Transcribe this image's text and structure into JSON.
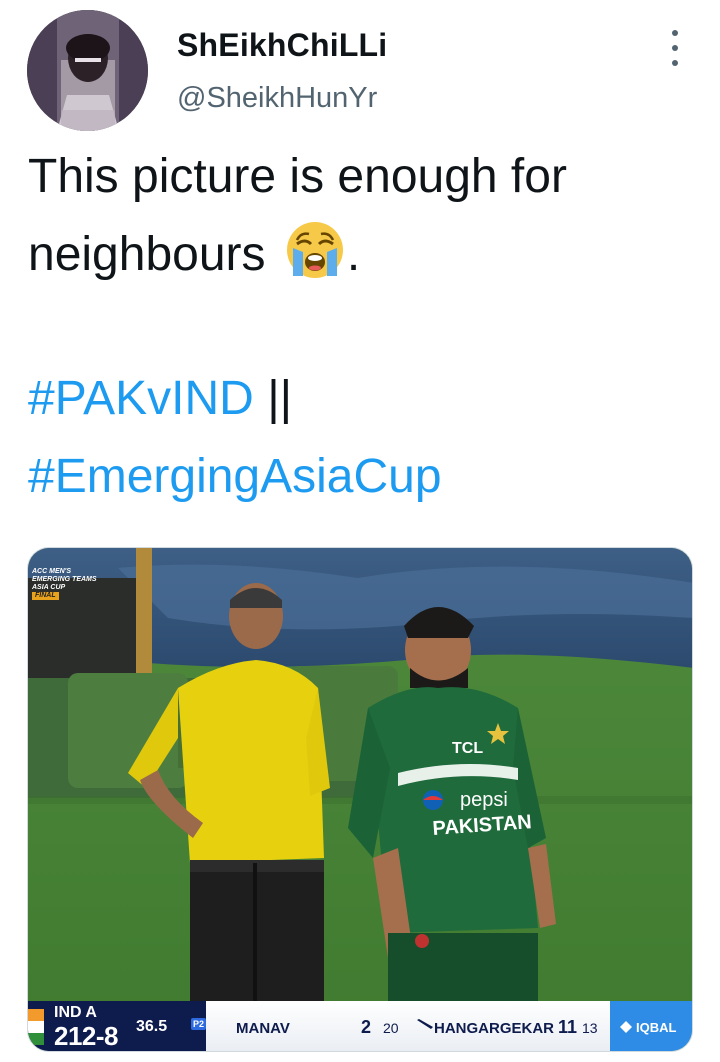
{
  "user": {
    "display_name": "ShEikhChiLLi",
    "handle": "@SheikhHunYr"
  },
  "tweet": {
    "text": "This picture is enough for neighbours",
    "emoji": "loudly-crying-face",
    "text_end": ".",
    "hashtag_1": "#PAKvIND",
    "separator": "||",
    "hashtag_2": "#EmergingAsiaCup"
  },
  "media": {
    "competition_badge": {
      "line1": "ACC MEN'S",
      "line2": "EMERGING TEAMS",
      "line3": "ASIA CUP",
      "stage": "FINAL"
    },
    "jersey_brand": "TCL",
    "jersey_sponsor": "pepsi",
    "jersey_country": "PAKISTAN",
    "scorebar": {
      "team": "IND A",
      "score": "212-8",
      "overs": "36.5",
      "powerplay": "P2",
      "batter_1_name": "MANAV",
      "batter_1_runs": "2",
      "batter_1_balls": "20",
      "batter_2_name": "HANGARGEKAR",
      "batter_2_runs": "11",
      "batter_2_balls": "13",
      "bowler_name": "IQBAL"
    }
  },
  "colors": {
    "text": "#0f1419",
    "secondary": "#536471",
    "link": "#1d9bf0",
    "scorebar_navy": "#0e1b4d",
    "scorebar_blue": "#2f8ce6"
  }
}
